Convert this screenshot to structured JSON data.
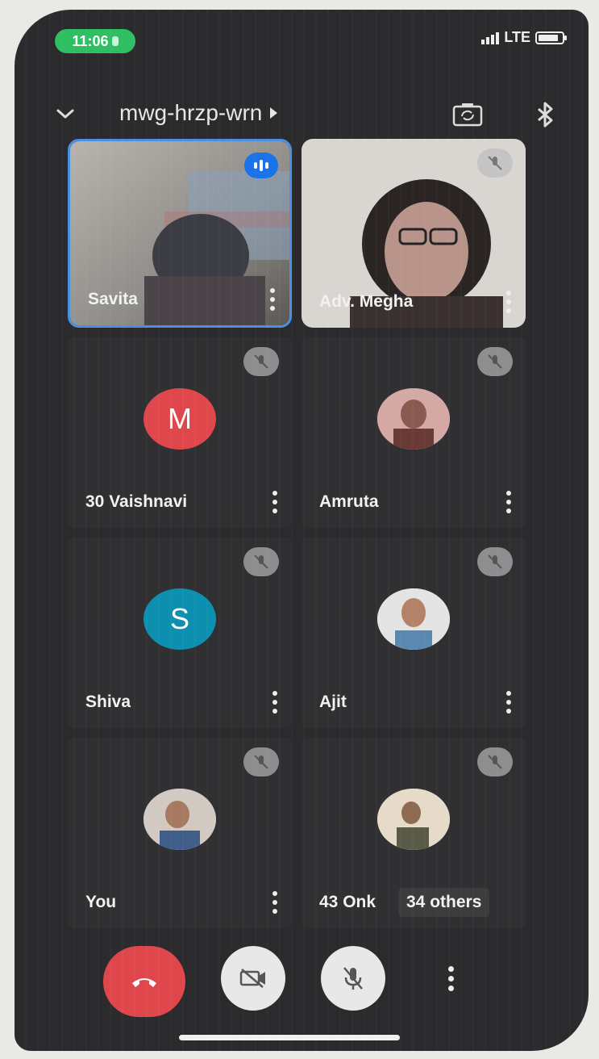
{
  "status_bar": {
    "time": "11:06",
    "network": "LTE"
  },
  "header": {
    "meeting_code": "mwg-hrzp-wrn"
  },
  "participants": [
    {
      "name": "Savita",
      "state": "speaking",
      "avatar": "video-feed"
    },
    {
      "name": "Adv. Megha",
      "state": "muted",
      "avatar": "video-feed"
    },
    {
      "name": "30 Vaishnavi",
      "state": "muted",
      "avatar_letter": "M",
      "avatar_color": "#e0474c"
    },
    {
      "name": "Amruta",
      "state": "muted",
      "avatar": "photo"
    },
    {
      "name": "Shiva",
      "state": "muted",
      "avatar_letter": "S",
      "avatar_color": "#0d8fb0"
    },
    {
      "name": "Ajit",
      "state": "muted",
      "avatar": "photo"
    },
    {
      "name": "You",
      "state": "muted",
      "avatar": "photo"
    },
    {
      "name": "43 Onk",
      "state": "muted",
      "avatar": "photo",
      "others_label": "34 others"
    }
  ],
  "controls": {
    "end_call_color": "#e0474c",
    "button_color": "#e8e8e8"
  },
  "icons": [
    "chevron-down-icon",
    "play-arrow-icon",
    "switch-camera-icon",
    "bluetooth-icon",
    "mic-off-icon",
    "more-vert-icon",
    "hangup-icon",
    "video-off-icon",
    "speaking-indicator-icon"
  ]
}
